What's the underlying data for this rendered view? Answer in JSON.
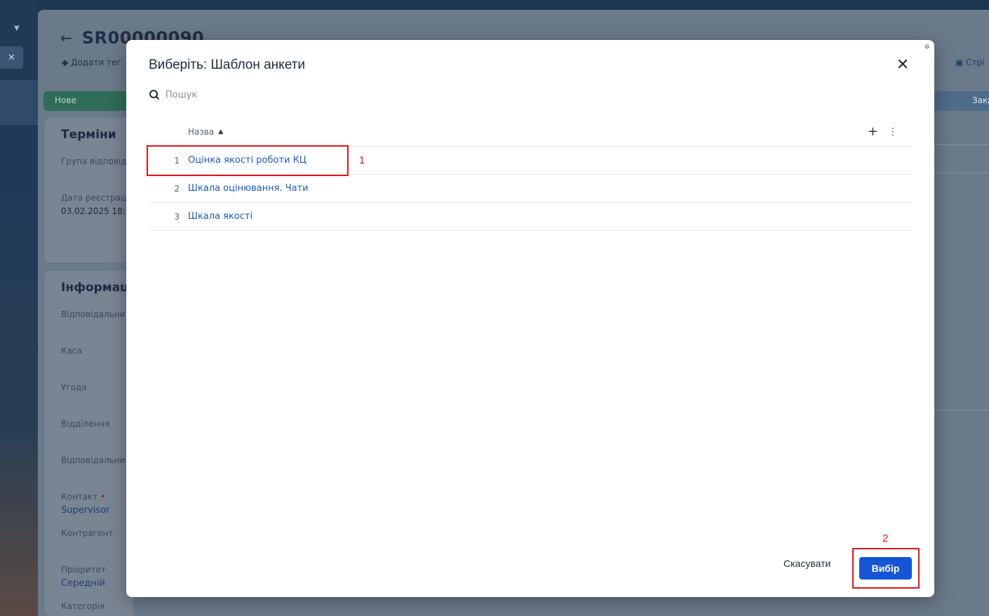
{
  "background": {
    "record_id": "SR00000090",
    "add_tag": "Додати тег",
    "share_label": "Стрі",
    "stage_new": "Нове",
    "stage_closed": "Закр",
    "section_terms": "Терміни",
    "label_group": "Група відповід",
    "label_reg_date": "Дата реєстрац",
    "value_reg_date": "03.02.2025 18:0",
    "section_info": "Інформація",
    "label_responsible": "Відповідальни",
    "label_cash": "Каса",
    "label_deal": "Угода",
    "label_branch": "Відділення",
    "label_responsible2": "Відповідальни",
    "label_contact": "Контакт",
    "value_contact": "Supervisor",
    "label_counterparty": "Контрагент",
    "label_priority": "Пріоритет",
    "value_priority": "Середній",
    "label_category": "Категорія"
  },
  "modal": {
    "title": "Виберіть: Шаблон анкети",
    "search_placeholder": "Пошук",
    "column_name": "Назва",
    "rows": [
      {
        "num": "1",
        "name": "Оцінка якості роботи КЦ"
      },
      {
        "num": "2",
        "name": "Шкала оцінювання. Чати"
      },
      {
        "num": "3",
        "name": "Шкала якості"
      }
    ],
    "cancel_label": "Скасувати",
    "select_label": "Вибір"
  },
  "annotations": {
    "label_1": "1",
    "label_2": "2",
    "color": "#e3141b"
  }
}
